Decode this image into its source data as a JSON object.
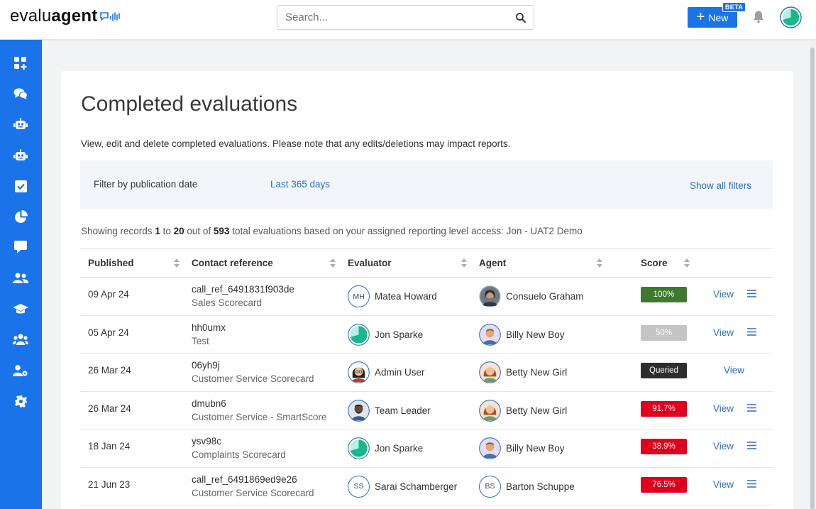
{
  "header": {
    "logo_light": "evalu",
    "logo_bold": "agent",
    "search_placeholder": "Search...",
    "new_label": "New",
    "beta_label": "BETA"
  },
  "colors": {
    "primary": "#1a73e8",
    "link": "#2f6fc1",
    "score_green": "#3e7a2e",
    "score_grey": "#c4c4c4",
    "score_dark": "#2d2d2d",
    "score_red": "#e0001b"
  },
  "sidebar": {
    "icons": [
      "dashboard-add-icon",
      "chat-bubbles-icon",
      "robot-icon",
      "robot-alt-icon",
      "checkbox-icon",
      "pie-chart-icon",
      "message-icon",
      "users-icon",
      "graduation-cap-icon",
      "team-icon",
      "user-settings-icon",
      "settings-gear-icon"
    ]
  },
  "page": {
    "title": "Completed evaluations",
    "description": "View, edit and delete completed evaluations. Please note that any edits/deletions may impact reports.",
    "filter": {
      "label": "Filter by publication date",
      "value": "Last 365 days",
      "show_all": "Show all filters"
    },
    "showing": {
      "prefix": "Showing records ",
      "from": "1",
      "to_word": " to ",
      "to": "20",
      "outof": " out of ",
      "total": "593",
      "suffix": " total evaluations based on your assigned reporting level access: Jon - UAT2 Demo"
    }
  },
  "table": {
    "columns": [
      "Published",
      "Contact reference",
      "Evaluator",
      "Agent",
      "Score"
    ],
    "rows": [
      {
        "date": "09 Apr 24",
        "ref": "call_ref_6491831f903de",
        "card": "Sales Scorecard",
        "evaluator": "Matea Howard",
        "evaluator_initials": "MH",
        "agent": "Consuelo Graham",
        "score": "100%",
        "score_color": "#3e7a2e",
        "view": "View"
      },
      {
        "date": "05 Apr 24",
        "ref": "hh0umx",
        "card": "Test",
        "evaluator": "Jon Sparke",
        "agent": "Billy New Boy",
        "score": "50%",
        "score_color": "#c4c4c4",
        "view": "View"
      },
      {
        "date": "26 Mar 24",
        "ref": "06yh9j",
        "card": "Customer Service Scorecard",
        "evaluator": "Admin User",
        "agent": "Betty New Girl",
        "score": "Queried",
        "score_color": "#2d2d2d",
        "view": "View"
      },
      {
        "date": "26 Mar 24",
        "ref": "dmubn6",
        "card": "Customer Service - SmartScore",
        "evaluator": "Team Leader",
        "agent": "Betty New Girl",
        "score": "91.7%",
        "score_color": "#e0001b",
        "view": "View"
      },
      {
        "date": "18 Jan 24",
        "ref": "ysv98c",
        "card": "Complaints Scorecard",
        "evaluator": "Jon Sparke",
        "agent": "Billy New Boy",
        "score": "38.9%",
        "score_color": "#e0001b",
        "view": "View"
      },
      {
        "date": "21 Jun 23",
        "ref": "call_ref_6491869ed9e26",
        "card": "Customer Service Scorecard",
        "evaluator": "Sarai Schamberger",
        "evaluator_initials": "SS",
        "agent": "Barton Schuppe",
        "agent_initials": "BS",
        "score": "76.5%",
        "score_color": "#e0001b",
        "view": "View"
      }
    ]
  }
}
